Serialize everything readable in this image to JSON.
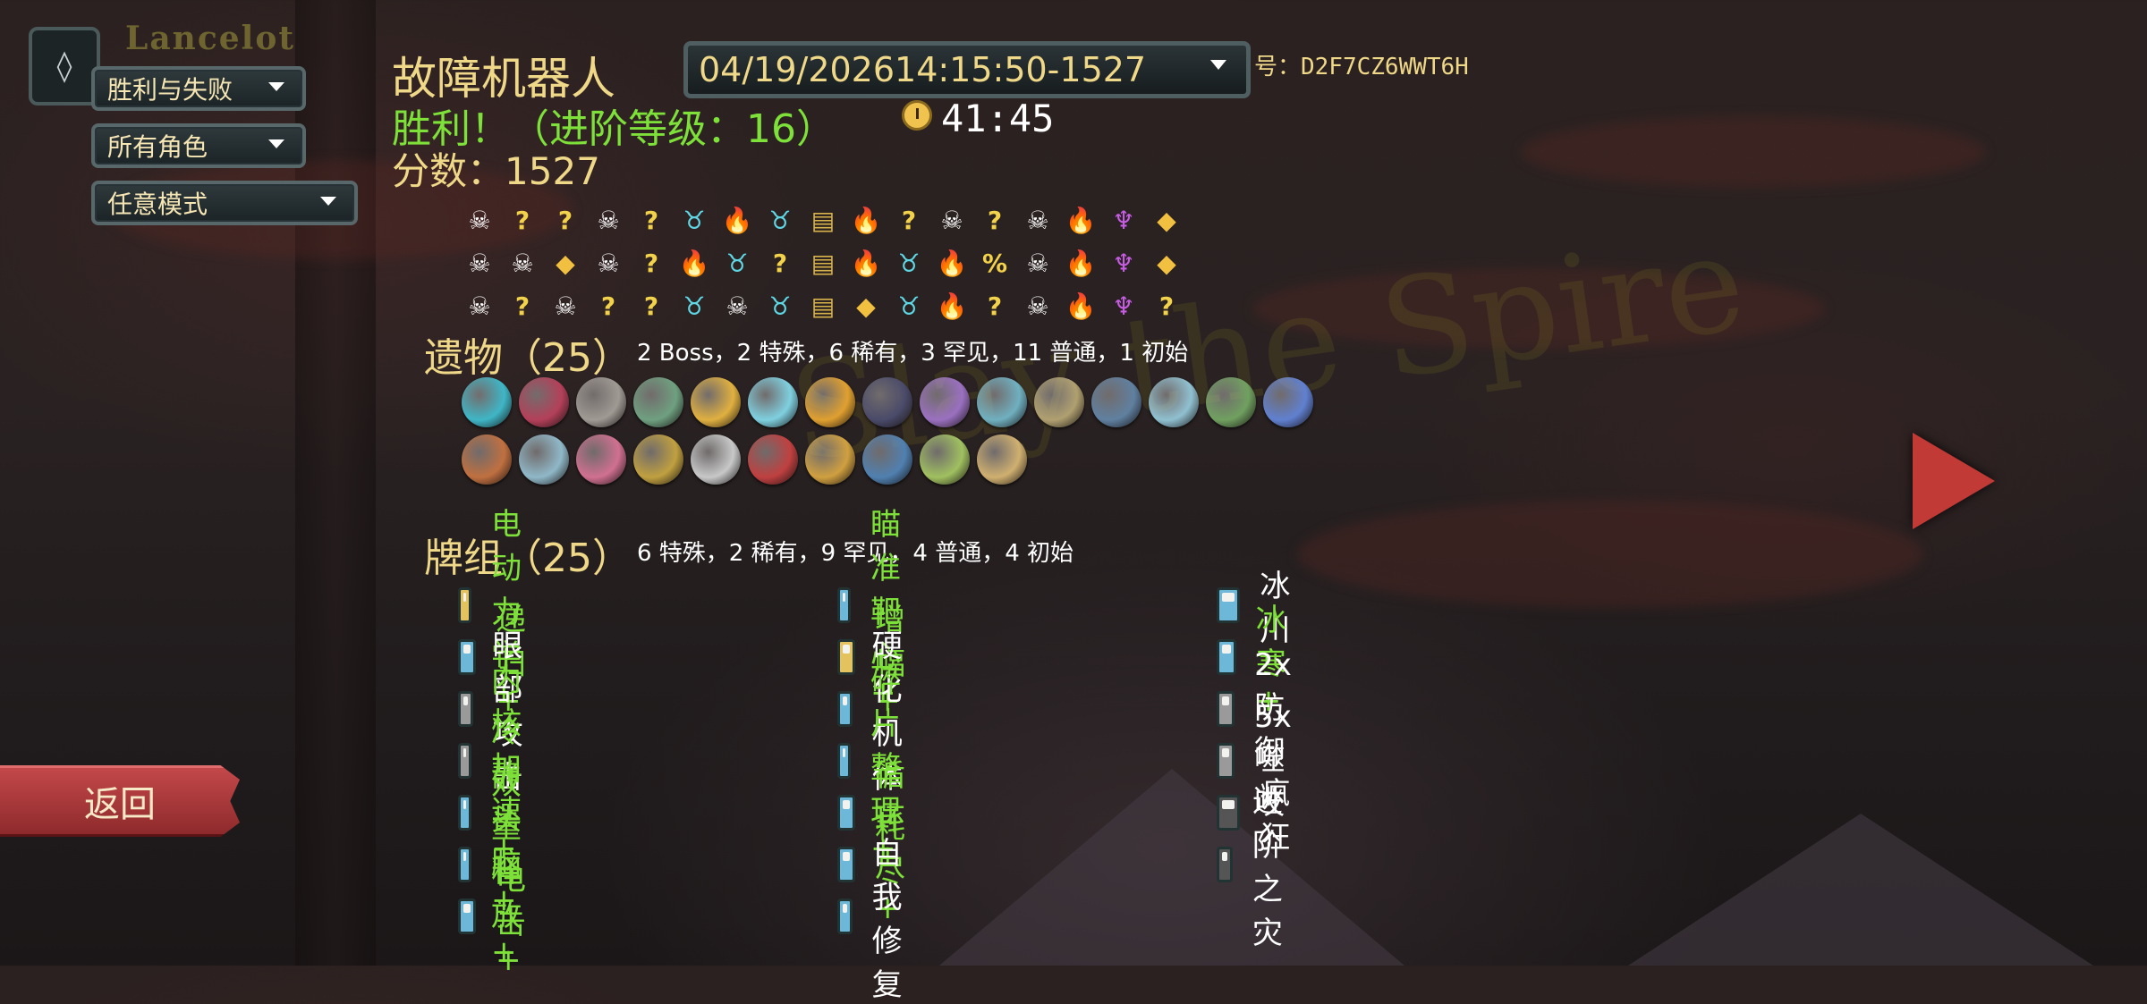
{
  "filters": {
    "player_name": "Lancelot",
    "outcome": "胜利与失败",
    "character": "所有角色",
    "mode": "任意模式"
  },
  "run": {
    "title": "故障机器人",
    "result": "胜利！（进阶等级：16）",
    "score": "分数：1527",
    "seed_value": "04/19/202614:15:50-1527",
    "seed_label": "号：D2F7CZ6WWT6H",
    "time": "41:45"
  },
  "path": {
    "rows": [
      [
        "monster",
        "q",
        "q",
        "monster",
        "q",
        "elite",
        "rest",
        "elite",
        "chest",
        "rest",
        "q",
        "monster",
        "q",
        "monster",
        "rest",
        "boss",
        "shop"
      ],
      [
        "monster",
        "monster",
        "shop",
        "monster",
        "q",
        "rest",
        "elite",
        "q",
        "chest",
        "rest",
        "elite",
        "rest",
        "mystery",
        "monster",
        "rest",
        "boss",
        "shop"
      ],
      [
        "monster",
        "q",
        "monster",
        "q",
        "q",
        "elite",
        "monster",
        "elite",
        "chest",
        "shop",
        "elite",
        "rest",
        "q",
        "monster",
        "rest",
        "boss",
        "q"
      ]
    ],
    "glyphs": {
      "monster": "☠",
      "q": "?",
      "elite": "♉",
      "rest": "🔥",
      "chest": "▤",
      "shop": "◆",
      "boss": "♆",
      "mystery": "%"
    }
  },
  "relics": {
    "title": "遗物（25）",
    "summary": "2  Boss，2  特殊，6  稀有，3  罕见，11  普通，1  初始",
    "items": [
      {
        "name": "orb",
        "color": "#3fb6c6"
      },
      {
        "name": "mask",
        "color": "#b4405a"
      },
      {
        "name": "statue",
        "color": "#a09a94"
      },
      {
        "name": "web",
        "color": "#6fa080"
      },
      {
        "name": "flower",
        "color": "#e0b040"
      },
      {
        "name": "ticket",
        "color": "#7fd0e0"
      },
      {
        "name": "disc",
        "color": "#e0a030"
      },
      {
        "name": "star",
        "color": "#4a4a6a"
      },
      {
        "name": "pearl",
        "color": "#9a70c0"
      },
      {
        "name": "beads",
        "color": "#70b0c0"
      },
      {
        "name": "hourglass",
        "color": "#b0a070"
      },
      {
        "name": "anchor",
        "color": "#6080a0"
      },
      {
        "name": "flask",
        "color": "#90c0d0"
      },
      {
        "name": "horn",
        "color": "#70a060"
      },
      {
        "name": "bird",
        "color": "#6080d0"
      },
      {
        "name": "chain",
        "color": "#c07040"
      },
      {
        "name": "tube",
        "color": "#90b8c8"
      },
      {
        "name": "pendant",
        "color": "#d07090"
      },
      {
        "name": "frame",
        "color": "#c0a040"
      },
      {
        "name": "note",
        "color": "#c8c8c8"
      },
      {
        "name": "nunchaku",
        "color": "#c04040"
      },
      {
        "name": "gear",
        "color": "#d0a040"
      },
      {
        "name": "shark",
        "color": "#5080b0"
      },
      {
        "name": "crystal",
        "color": "#a0c060"
      },
      {
        "name": "lantern",
        "color": "#d0b070"
      }
    ]
  },
  "deck": {
    "title": "牌组（25）",
    "summary": "6  特殊，2  稀有，9  罕见，4  普通，4  初始",
    "columns": [
      [
        {
          "label": "电动力学+",
          "upgraded": true,
          "icon": "gold"
        },
        {
          "label": "递归+",
          "upgraded": true,
          "icon": "blue"
        },
        {
          "label": "眼部攻击",
          "upgraded": false,
          "icon": "gray"
        },
        {
          "label": "内核加速+",
          "upgraded": true,
          "icon": "gray"
        },
        {
          "label": "冷静头脑+",
          "upgraded": true,
          "icon": "blue"
        },
        {
          "label": "双重释放+",
          "upgraded": true,
          "icon": "blue"
        },
        {
          "label": "电击+",
          "upgraded": true,
          "icon": "blue"
        }
      ],
      [
        {
          "label": "瞄准靶心+",
          "upgraded": true,
          "icon": "blue"
        },
        {
          "label": "增幅+",
          "upgraded": true,
          "icon": "gold"
        },
        {
          "label": "硬化机体",
          "upgraded": false,
          "icon": "blue"
        },
        {
          "label": "碎片整理+",
          "upgraded": true,
          "icon": "blue"
        },
        {
          "label": "循环+",
          "upgraded": true,
          "icon": "blue"
        },
        {
          "label": "耗尽+",
          "upgraded": true,
          "icon": "blue"
        },
        {
          "label": "自我修复",
          "upgraded": false,
          "icon": "blue"
        }
      ],
      [
        {
          "label": "冰川",
          "upgraded": false,
          "icon": "blue"
        },
        {
          "label": "冰寒+",
          "upgraded": true,
          "icon": "blue"
        },
        {
          "label": "2x防御",
          "upgraded": false,
          "icon": "gray"
        },
        {
          "label": "5x噬咬",
          "upgraded": false,
          "icon": "gray"
        },
        {
          "label": "疯狂",
          "upgraded": false,
          "icon": "dark"
        },
        {
          "label": "进阶之灾",
          "upgraded": false,
          "icon": "dark"
        }
      ]
    ]
  },
  "nav": {
    "back_label": "返回"
  },
  "background": {
    "logo_text": "Slay the Spire"
  },
  "colors": {
    "gold_text": "#f0d889",
    "upgraded_green": "#7ee13a",
    "back_button": "#b03c3e",
    "next_arrow": "#c23a36"
  }
}
